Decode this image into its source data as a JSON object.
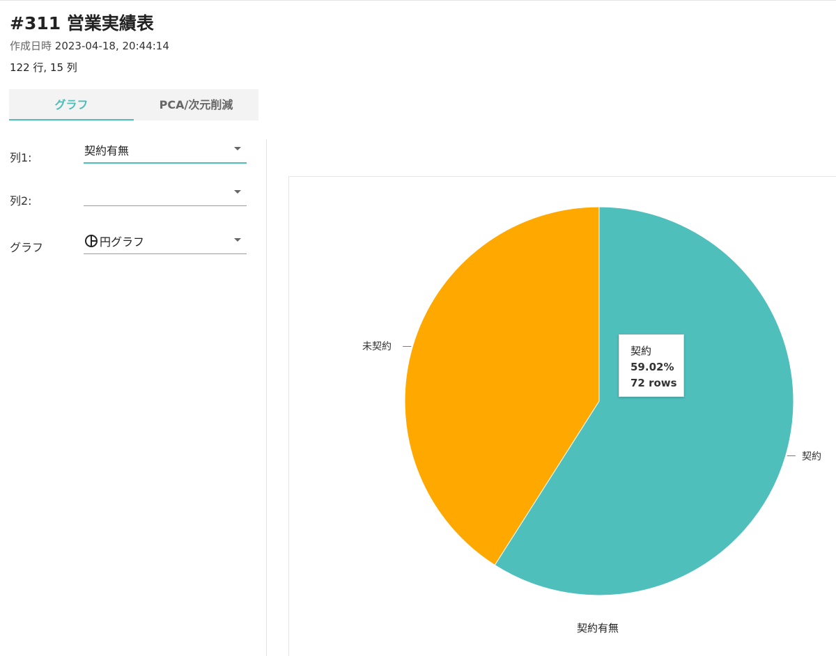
{
  "header": {
    "title": "#311 営業実績表",
    "created_label": "作成日時",
    "created_value": "2023-04-18, 20:44:14",
    "dimensions": "122 行, 15 列"
  },
  "tabs": [
    {
      "label": "グラフ",
      "active": true
    },
    {
      "label": "PCA/次元削減",
      "active": false
    }
  ],
  "form": {
    "col1_label": "列1:",
    "col1_value": "契約有無",
    "col2_label": "列2:",
    "col2_value": "",
    "graph_label": "グラフ",
    "graph_value": "円グラフ",
    "graph_icon": "pie-chart-icon"
  },
  "chart_data": {
    "type": "pie",
    "xlabel": "契約有無",
    "slices": [
      {
        "label": "契約",
        "value": 72,
        "percent": 59.02,
        "color": "#4fbfbc"
      },
      {
        "label": "未契約",
        "value": 50,
        "percent": 40.98,
        "color": "#ffa900"
      }
    ],
    "tooltip": {
      "name": "契約",
      "percent": "59.02%",
      "rows": "72 rows"
    }
  }
}
